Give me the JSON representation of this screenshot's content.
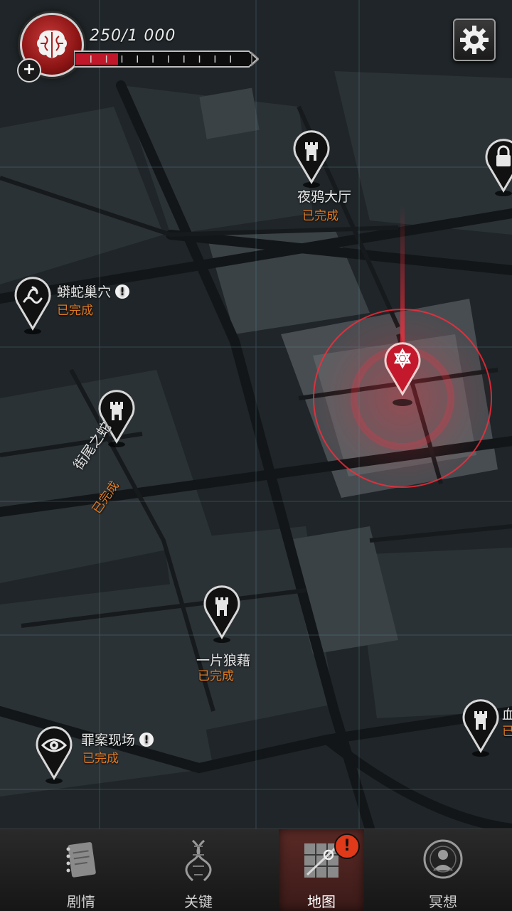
{
  "hud": {
    "energy_text": "250/1 000",
    "energy_fraction": 0.25,
    "avatar_icon": "brain-icon",
    "add_icon": "plus-icon",
    "settings_icon": "gear-icon"
  },
  "locations": [
    {
      "id": "raven-hall",
      "name": "夜鸦大厅",
      "status": "已完成",
      "icon": "tower-icon",
      "alert": false
    },
    {
      "id": "locked",
      "name": "",
      "status": "",
      "icon": "lock-icon",
      "alert": false
    },
    {
      "id": "python-nest",
      "name": "蟒蛇巢穴",
      "status": "已完成",
      "icon": "serpent-icon",
      "alert": true,
      "alert_text": "!"
    },
    {
      "id": "street-snake",
      "name": "街尾之蛇",
      "status": "已完成",
      "icon": "tower-icon",
      "alert": false
    },
    {
      "id": "mess",
      "name": "一片狼藉",
      "status": "已完成",
      "icon": "tower-icon",
      "alert": false
    },
    {
      "id": "crime-scene",
      "name": "罪案现场",
      "status": "已完成",
      "icon": "eye-icon",
      "alert": true,
      "alert_text": "!"
    },
    {
      "id": "blood",
      "name": "血",
      "status": "已",
      "icon": "tower-icon",
      "alert": false
    },
    {
      "id": "current",
      "name": "",
      "status": "",
      "icon": "hexagram-icon",
      "alert": false
    }
  ],
  "nav": {
    "items": [
      {
        "label": "剧情",
        "icon": "notebook-icon",
        "active": false
      },
      {
        "label": "关键",
        "icon": "dna-icon",
        "active": false
      },
      {
        "label": "地图",
        "icon": "map-icon",
        "active": true
      },
      {
        "label": "冥想",
        "icon": "meditation-icon",
        "active": false
      }
    ],
    "badge_text": "!"
  },
  "colors": {
    "accent_red": "#e0223a",
    "status_orange": "#e07a24",
    "map_bg": "#1e2326"
  }
}
